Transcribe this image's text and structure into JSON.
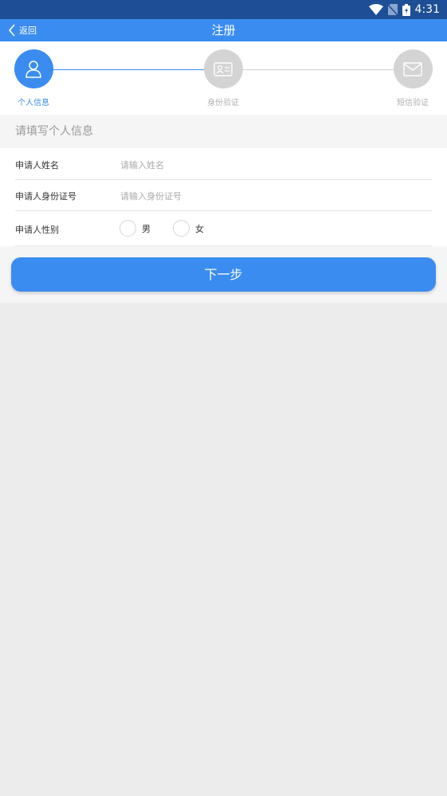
{
  "status_bar": {
    "time": "4:31"
  },
  "app_bar": {
    "back_label": "返回",
    "title": "注册"
  },
  "steps": [
    {
      "label": "个人信息",
      "active": true,
      "icon": "person-icon"
    },
    {
      "label": "身份验证",
      "active": false,
      "icon": "id-card-icon"
    },
    {
      "label": "短信验证",
      "active": false,
      "icon": "mail-icon"
    }
  ],
  "section_title": "请填写个人信息",
  "form": {
    "name_label": "申请人姓名",
    "name_placeholder": "请输入姓名",
    "id_label": "申请人身份证号",
    "id_placeholder": "请输入身份证号",
    "gender_label": "申请人性别",
    "gender_options": [
      "男",
      "女"
    ]
  },
  "next_button": "下一步",
  "colors": {
    "primary": "#3a8cf0",
    "status_bar": "#1e4f96",
    "inactive": "#d4d4d4"
  }
}
